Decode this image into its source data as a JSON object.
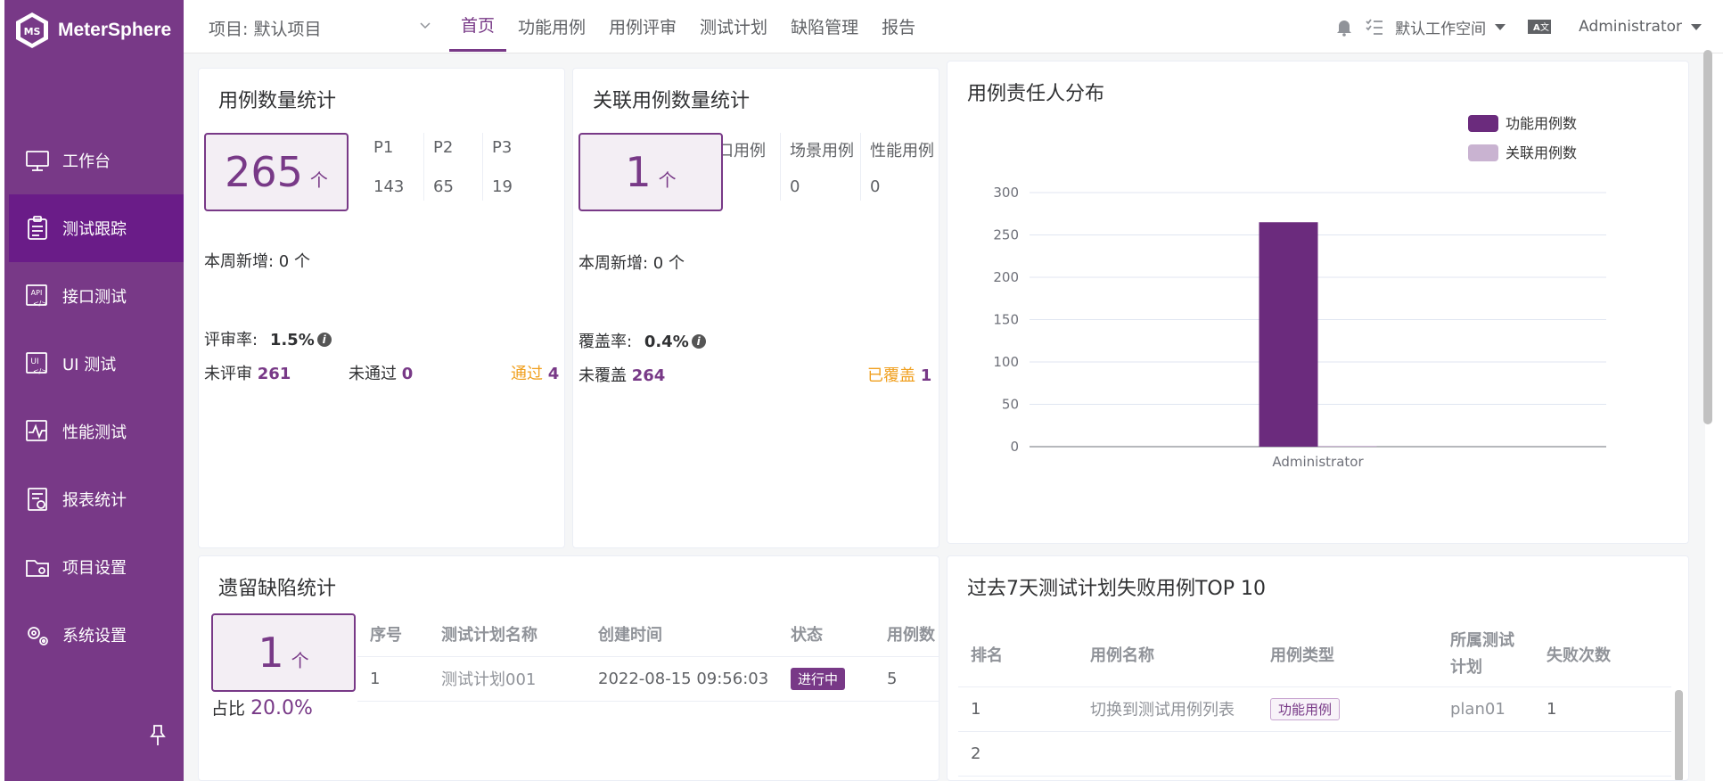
{
  "app": {
    "logo_text": "MeterSphere"
  },
  "sidebar": {
    "items": [
      {
        "label": "工作台",
        "icon": "monitor-icon"
      },
      {
        "label": "测试跟踪",
        "icon": "clipboard-icon"
      },
      {
        "label": "接口测试",
        "icon": "api-icon"
      },
      {
        "label": "UI 测试",
        "icon": "ui-icon"
      },
      {
        "label": "性能测试",
        "icon": "performance-icon"
      },
      {
        "label": "报表统计",
        "icon": "report-icon"
      },
      {
        "label": "项目设置",
        "icon": "folder-settings-icon"
      },
      {
        "label": "系统设置",
        "icon": "gears-icon"
      }
    ],
    "active_index": 1
  },
  "header": {
    "project_label": "项目: 默认项目",
    "tabs": [
      "首页",
      "功能用例",
      "用例评审",
      "测试计划",
      "缺陷管理",
      "报告"
    ],
    "active_tab": 0,
    "workspace": "默认工作空间",
    "user": "Administrator"
  },
  "case_stats": {
    "title": "用例数量统计",
    "total": "265",
    "unit": "个",
    "priorities": [
      {
        "label": "P1",
        "value": "143"
      },
      {
        "label": "P2",
        "value": "65"
      },
      {
        "label": "P3",
        "value": "19"
      }
    ],
    "weekly_new_label": "本周新增: 0 个",
    "review_rate_label": "评审率:",
    "review_rate": "1.5%",
    "not_reviewed_label": "未评审",
    "not_reviewed": "261",
    "not_passed_label": "未通过",
    "not_passed": "0",
    "passed_label": "通过",
    "passed": "4"
  },
  "related_stats": {
    "title": "关联用例数量统计",
    "total": "1",
    "unit": "个",
    "columns": [
      {
        "label": "口用例",
        "value": ""
      },
      {
        "label": "场景用例",
        "value": "0"
      },
      {
        "label": "性能用例",
        "value": "0"
      }
    ],
    "weekly_new_label": "本周新增: 0 个",
    "coverage_label": "覆盖率:",
    "coverage": "0.4%",
    "uncovered_label": "未覆盖",
    "uncovered": "264",
    "covered_label": "已覆盖",
    "covered": "1"
  },
  "owner_chart": {
    "title": "用例责任人分布",
    "legend": [
      "功能用例数",
      "关联用例数"
    ]
  },
  "chart_data": {
    "type": "bar",
    "title": "用例责任人分布",
    "categories": [
      "Administrator"
    ],
    "series": [
      {
        "name": "功能用例数",
        "values": [
          265
        ],
        "color": "#6b2b7d"
      },
      {
        "name": "关联用例数",
        "values": [
          1
        ],
        "color": "#c9b3d1"
      }
    ],
    "yticks": [
      0,
      50,
      100,
      150,
      200,
      250,
      300
    ],
    "ylim": [
      0,
      300
    ],
    "legend_position": "top-right",
    "grid": true
  },
  "defects": {
    "title": "遗留缺陷统计",
    "total": "1",
    "unit": "个",
    "ratio_label": "占比",
    "ratio": "20.0%",
    "columns": [
      "序号",
      "测试计划名称",
      "创建时间",
      "状态",
      "用例数"
    ],
    "rows": [
      {
        "no": "1",
        "name": "测试计划001",
        "created": "2022-08-15 09:56:03",
        "status": "进行中",
        "cases": "5"
      }
    ]
  },
  "top_failures": {
    "title": "过去7天测试计划失败用例TOP 10",
    "columns": [
      "排名",
      "用例名称",
      "用例类型",
      "所属测试计划",
      "失败次数"
    ],
    "col_plan_line1": "所属测试",
    "col_plan_line2": "计划",
    "rows": [
      {
        "rank": "1",
        "name": "切换到测试用例列表",
        "type": "功能用例",
        "plan": "plan01",
        "fails": "1"
      },
      {
        "rank": "2",
        "name": "",
        "type": "",
        "plan": "",
        "fails": ""
      }
    ]
  }
}
